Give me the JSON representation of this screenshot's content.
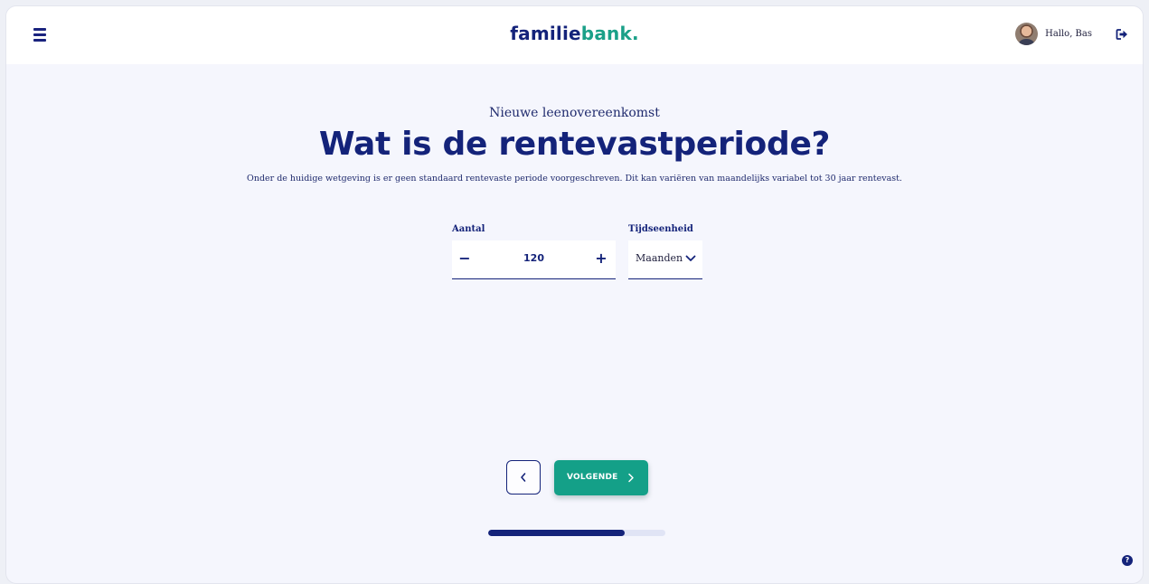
{
  "header": {
    "brand_part1": "familie",
    "brand_part2": "bank",
    "brand_dot": ".",
    "greeting": "Hallo, Bas",
    "menu_icon": "hamburger-icon",
    "logout_icon": "logout-icon"
  },
  "main": {
    "subtitle": "Nieuwe leenovereenkomst",
    "title": "Wat is de rentevastperiode?",
    "description": "Onder de huidige wetgeving is er geen standaard rentevaste periode voorgeschreven. Dit kan variëren van maandelijks variabel tot 30 jaar rentevast."
  },
  "form": {
    "amount_label": "Aantal",
    "amount_value": "120",
    "minus_label": "−",
    "plus_label": "+",
    "unit_label": "Tijdseenheid",
    "unit_value": "Maanden"
  },
  "nav": {
    "next_label": "VOLGENDE",
    "back_icon": "chevron-left-icon",
    "next_icon": "chevron-right-icon"
  },
  "progress": {
    "fraction": 0.77
  },
  "help": {
    "label": "?"
  },
  "colors": {
    "brand_navy": "#14237a",
    "brand_green": "#14a088",
    "background": "#f5f6fd"
  }
}
